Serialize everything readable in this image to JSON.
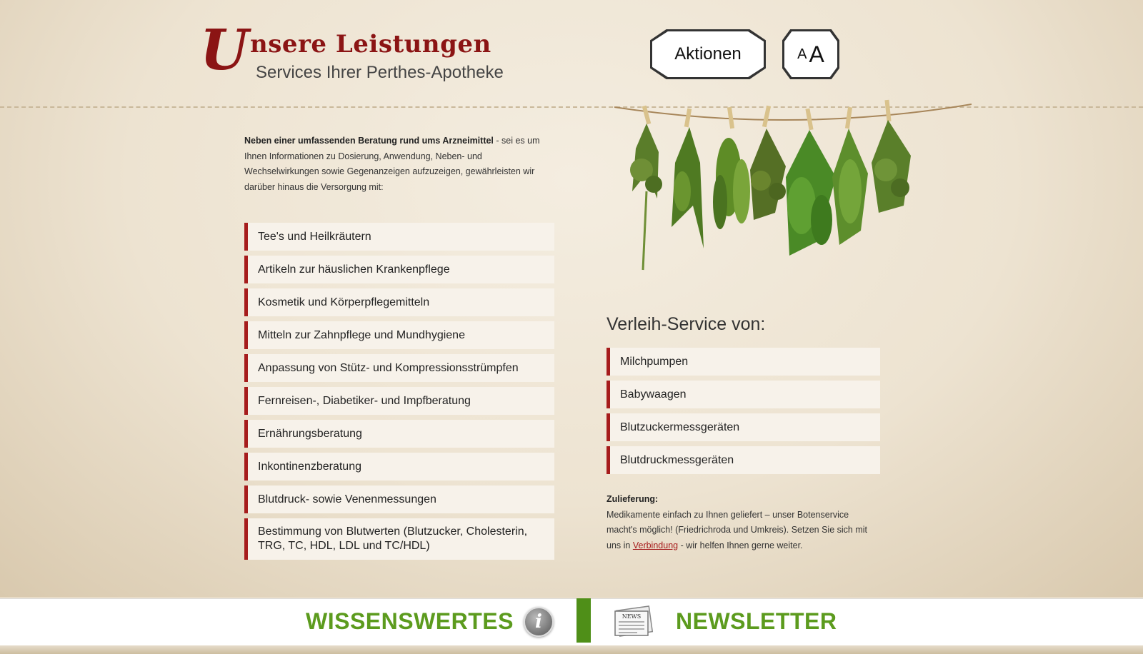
{
  "header": {
    "logo_initial": "U",
    "logo_title": "nsere Leistungen",
    "subtitle": "Services Ihrer Perthes-Apotheke",
    "aktionen_label": "Aktionen",
    "font_small": "A",
    "font_large": "A"
  },
  "intro": {
    "bold": "Neben einer umfassenden Beratung rund ums Arzneimittel",
    "text": " - sei es um Ihnen Informationen zu Dosierung, Anwendung, Neben- und Wechselwirkungen sowie Gegenanzeigen aufzuzeigen, gewährleisten wir darüber hinaus die Versorgung mit:"
  },
  "services": [
    "Tee's und Heilkräutern",
    "Artikeln zur häuslichen Krankenpflege",
    "Kosmetik und Körperpflegemitteln",
    "Mitteln zur Zahnpflege und Mundhygiene",
    "Anpassung von Stütz- und Kompressionsstrümpfen",
    "Fernreisen-, Diabetiker- und Impfberatung",
    "Ernährungsberatung",
    "Inkontinenzberatung",
    "Blutdruck- sowie Venenmessungen",
    "Bestimmung von Blutwerten (Blutzucker, Cholesterin, TRG, TC, HDL, LDL und TC/HDL)"
  ],
  "verleih": {
    "title": "Verleih-Service von:",
    "items": [
      "Milchpumpen",
      "Babywaagen",
      "Blutzuckermessgeräten",
      "Blutdruckmessgeräten"
    ]
  },
  "zulieferung": {
    "heading": "Zulieferung:",
    "text_before": "Medikamente einfach zu Ihnen geliefert – unser Botenservice macht's möglich! (Friedrichroda und Umkreis). Setzen Sie sich mit uns in ",
    "link": "Verbindung",
    "text_after": " - wir helfen Ihnen gerne weiter."
  },
  "footer": {
    "wissenswertes": "WISSENSWERTES",
    "newsletter": "NEWSLETTER",
    "info_glyph": "i",
    "news_icon_text": "NEWS"
  },
  "colors": {
    "accent_red": "#a61c1c",
    "logo_red": "#8b1414",
    "footer_green": "#5c9b1e"
  },
  "icons": [
    "info-icon",
    "newspaper-icon",
    "herbs-illustration"
  ]
}
